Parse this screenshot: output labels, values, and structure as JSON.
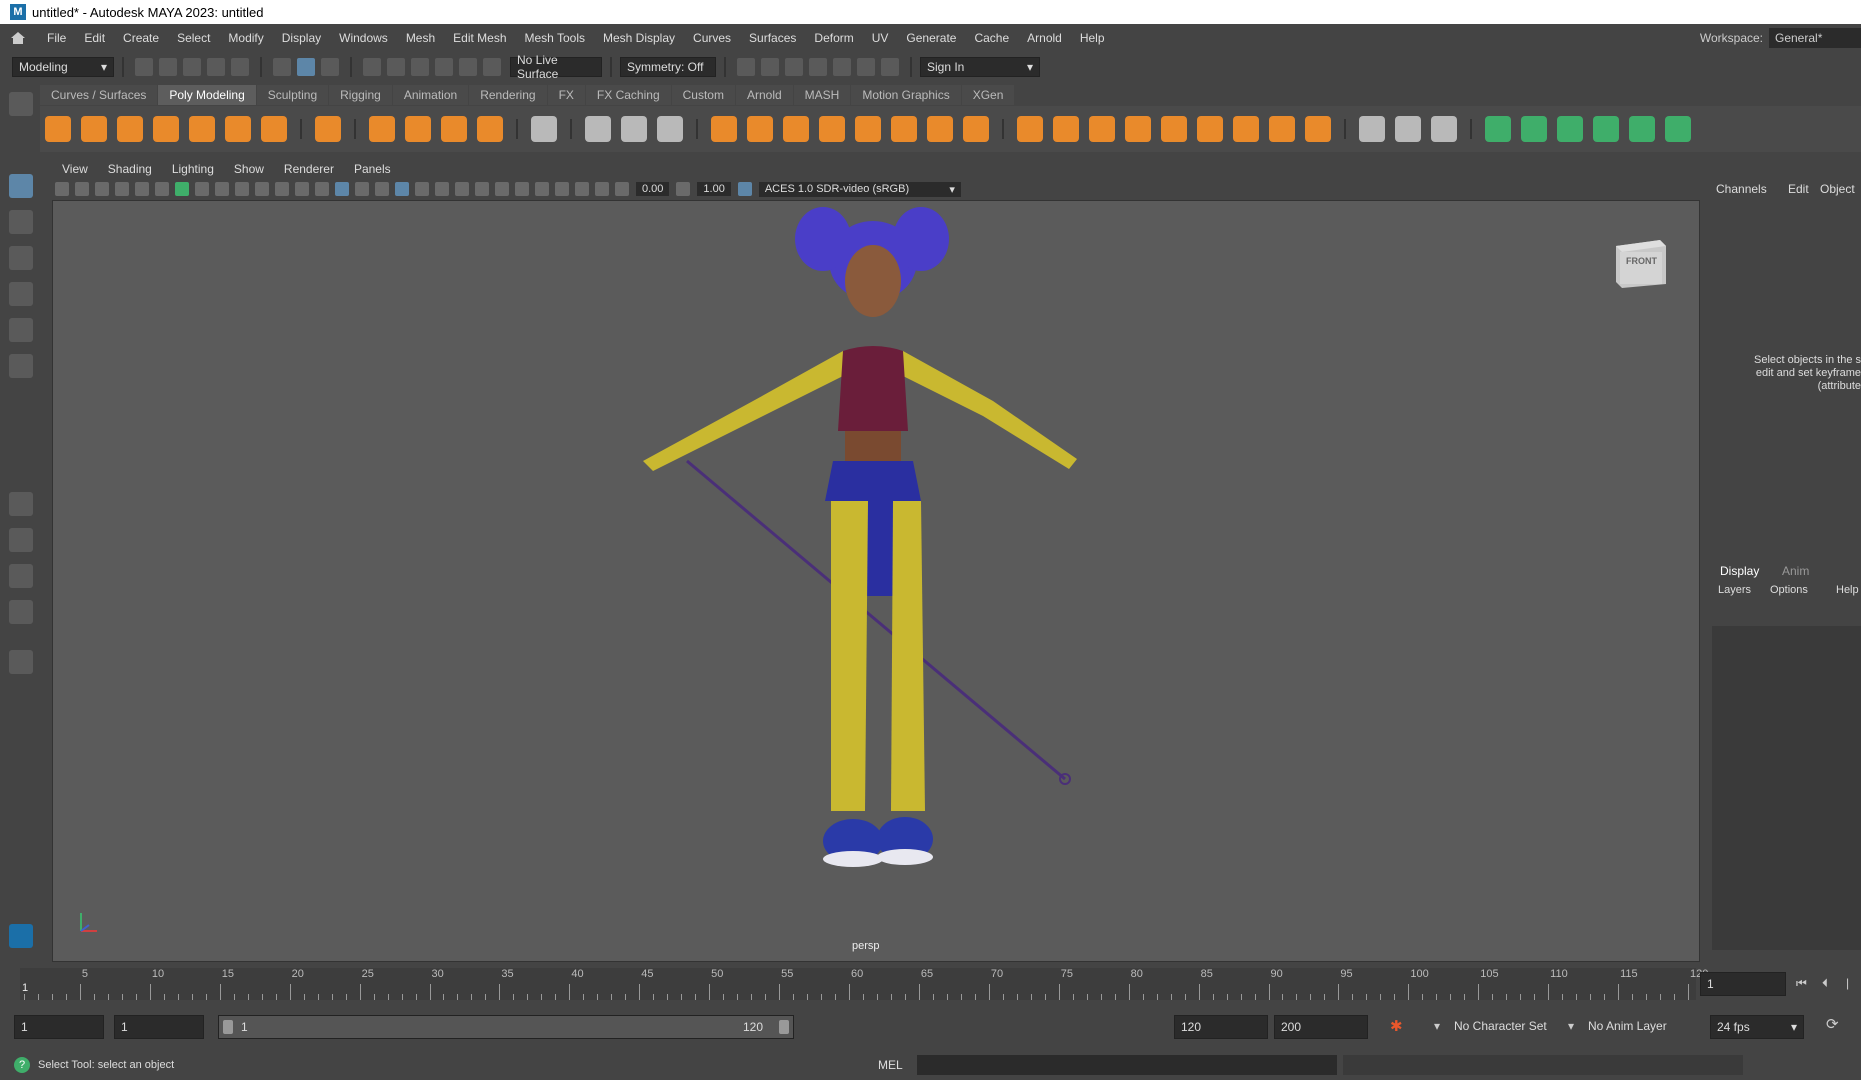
{
  "title": "untitled* - Autodesk MAYA 2023: untitled",
  "app_icon_letter": "M",
  "menu": [
    "File",
    "Edit",
    "Create",
    "Select",
    "Modify",
    "Display",
    "Windows",
    "Mesh",
    "Edit Mesh",
    "Mesh Tools",
    "Mesh Display",
    "Curves",
    "Surfaces",
    "Deform",
    "UV",
    "Generate",
    "Cache",
    "Arnold",
    "Help"
  ],
  "workspace": {
    "label": "Workspace:",
    "value": "General*"
  },
  "status": {
    "mode": "Modeling",
    "live_surface": "No Live Surface",
    "symmetry": "Symmetry: Off",
    "sign_in": "Sign In"
  },
  "shelf_tabs": [
    "Curves / Surfaces",
    "Poly Modeling",
    "Sculpting",
    "Rigging",
    "Animation",
    "Rendering",
    "FX",
    "FX Caching",
    "Custom",
    "Arnold",
    "MASH",
    "Motion Graphics",
    "XGen"
  ],
  "shelf_active": "Poly Modeling",
  "viewport_menu": [
    "View",
    "Shading",
    "Lighting",
    "Show",
    "Renderer",
    "Panels"
  ],
  "viewport_fields": {
    "exposure": "0.00",
    "gamma": "1.00",
    "colorspace": "ACES 1.0 SDR-video (sRGB)"
  },
  "viewcube_label": "FRONT",
  "camera_label": "persp",
  "right_panel": {
    "tabs": [
      "Channels",
      "Edit",
      "Object"
    ],
    "hint": "Select objects in the s edit and set keyframe (attribute",
    "layer_tabs": [
      "Display",
      "Anim"
    ],
    "layer_menu": [
      "Layers",
      "Options",
      "Help"
    ]
  },
  "timeline": {
    "ticks": [
      5,
      10,
      15,
      20,
      25,
      30,
      35,
      40,
      45,
      50,
      55,
      60,
      65,
      70,
      75,
      80,
      85,
      90,
      95,
      100,
      105,
      110,
      115,
      120
    ],
    "start": "1",
    "current_frame": "1"
  },
  "range": {
    "start": "1",
    "playback_start": "1",
    "slider_start": "1",
    "slider_end": "120",
    "playback_end": "120",
    "end": "200",
    "character_set": "No Character Set",
    "anim_layer": "No Anim Layer",
    "fps": "24 fps"
  },
  "command": {
    "lang": "MEL"
  },
  "help_text": "Select Tool: select an object",
  "colors": {
    "accent_orange": "#e98a2b",
    "accent_green": "#3fae6a",
    "viewport_bg": "#5b5b5b"
  }
}
